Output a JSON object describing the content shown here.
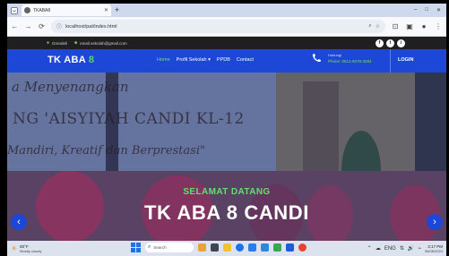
{
  "browser": {
    "tab_title": "TKABA8",
    "tab_close": "✕",
    "new_tab": "+",
    "window_controls": [
      "–",
      "□",
      "✕"
    ],
    "url": "localhost/pat/index.html",
    "nav": {
      "back": "←",
      "forward": "→",
      "reload": "⟳"
    },
    "toolbar_icons": [
      "☆",
      "⊡",
      "▣",
      "●",
      "⋮"
    ]
  },
  "site": {
    "topbar": {
      "location": "Grendeli",
      "email": "email.sekolah@gmail.com",
      "socials": [
        "f",
        "t",
        "i"
      ]
    },
    "navbar": {
      "brand_text": "TK ABA ",
      "brand_number": "8",
      "menu": [
        "Home",
        "Profil Sekolah ▾",
        "PPDB",
        "Contact"
      ],
      "active_menu": "Home",
      "phone_label": "Hubungi",
      "phone_number": "Phone: 0812-9278-3284",
      "login": "LOGIN"
    },
    "hero": {
      "banner_lines": [
        "a Menyenangkan",
        "NG 'AISYIYAH CANDI KL-12",
        "Mandiri, Kreatif dan Berprestasi\""
      ],
      "subtitle": "SELAMAT DATANG",
      "title": "TK ABA 8 CANDI",
      "prev": "‹",
      "next": "›"
    }
  },
  "taskbar": {
    "weather_temp": "80°F",
    "weather_desc": "Mostly cloudy",
    "search_placeholder": "Search",
    "time": "3:17 PM",
    "date": "06/06/2024",
    "tray_icons": [
      "⌃",
      "☁",
      "ENG",
      "⇅",
      "🔊",
      "⌁"
    ]
  }
}
